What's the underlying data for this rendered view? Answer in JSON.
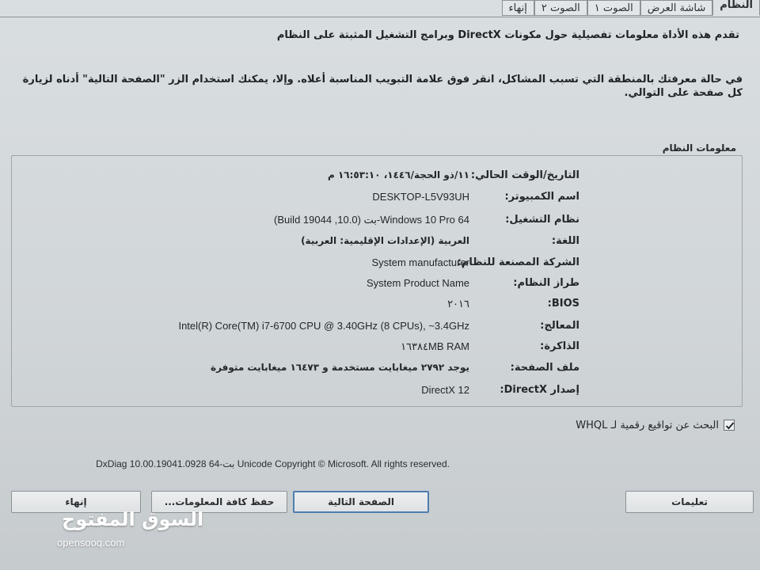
{
  "tabs": [
    {
      "label": "إنهاء",
      "active": false
    },
    {
      "label": "الصوت ٢",
      "active": false
    },
    {
      "label": "الصوت ١",
      "active": false
    },
    {
      "label": "شاشة العرض",
      "active": false
    },
    {
      "label": "النظام",
      "active": true
    }
  ],
  "intro": {
    "line1": "تقدم هذه الأداة معلومات تفصيلية حول مكونات DirectX وبرامج التشغيل المثبتة على النظام",
    "line2": "في حالة معرفتك بالمنطقة التي تسبب المشاكل، انقر فوق علامة التبويب المناسبة أعلاه. وإلا، يمكنك استخدام الزر \"الصفحة التالية\" أدناه لزيارة كل صفحة على التوالي."
  },
  "system_info": {
    "group_label": "معلومات النظام",
    "rows": [
      {
        "label": "التاريخ/الوقت الحالي:",
        "value": "١١/ذو الحجة/١٤٤٦، ١٦:٥٣:١٠ م"
      },
      {
        "label": "اسم الكمبيوتر:",
        "value": "DESKTOP-L5V93UH"
      },
      {
        "label": "نظام التشغيل:",
        "value": "Windows 10 Pro 64-بت (10.0, Build 19044)"
      },
      {
        "label": "اللغة:",
        "value": "العربية (الإعدادات الإقليمية: العربية)"
      },
      {
        "label": "الشركة المصنعة للنظام:",
        "value": "System manufacturer"
      },
      {
        "label": "طراز النظام:",
        "value": "System Product Name"
      },
      {
        "label": "BIOS:",
        "value": "٢٠١٦"
      },
      {
        "label": "المعالج:",
        "value": "Intel(R) Core(TM) i7-6700 CPU @ 3.40GHz (8 CPUs), ~3.4GHz"
      },
      {
        "label": "الذاكرة:",
        "value": "١٦٣٨٤MB RAM"
      },
      {
        "label": "ملف الصفحة:",
        "value": "يوجد ٢٧٩٢ ميغابايت مستخدمة و ١٦٤٧٣ ميغابايت متوفرة"
      },
      {
        "label": "إصدار DirectX:",
        "value": "DirectX 12"
      }
    ]
  },
  "whql": {
    "label": "البحث عن تواقيع رقمية لـ WHQL",
    "checked": true
  },
  "copyright": "DxDiag 10.00.19041.0928 64-بت Unicode  Copyright © Microsoft. All rights reserved.",
  "buttons": {
    "help": "تعليمات",
    "next_page": "الصفحة التالية",
    "save_all": "حفظ كافة المعلومات...",
    "exit": "إنهاء"
  },
  "watermark": {
    "arabic": "السوق المفتوح",
    "english": "opensooq.com"
  },
  "colors": {
    "window_bg": "#d5dadd",
    "primary_button_border": "#4f7fb0",
    "text": "#23272a"
  }
}
